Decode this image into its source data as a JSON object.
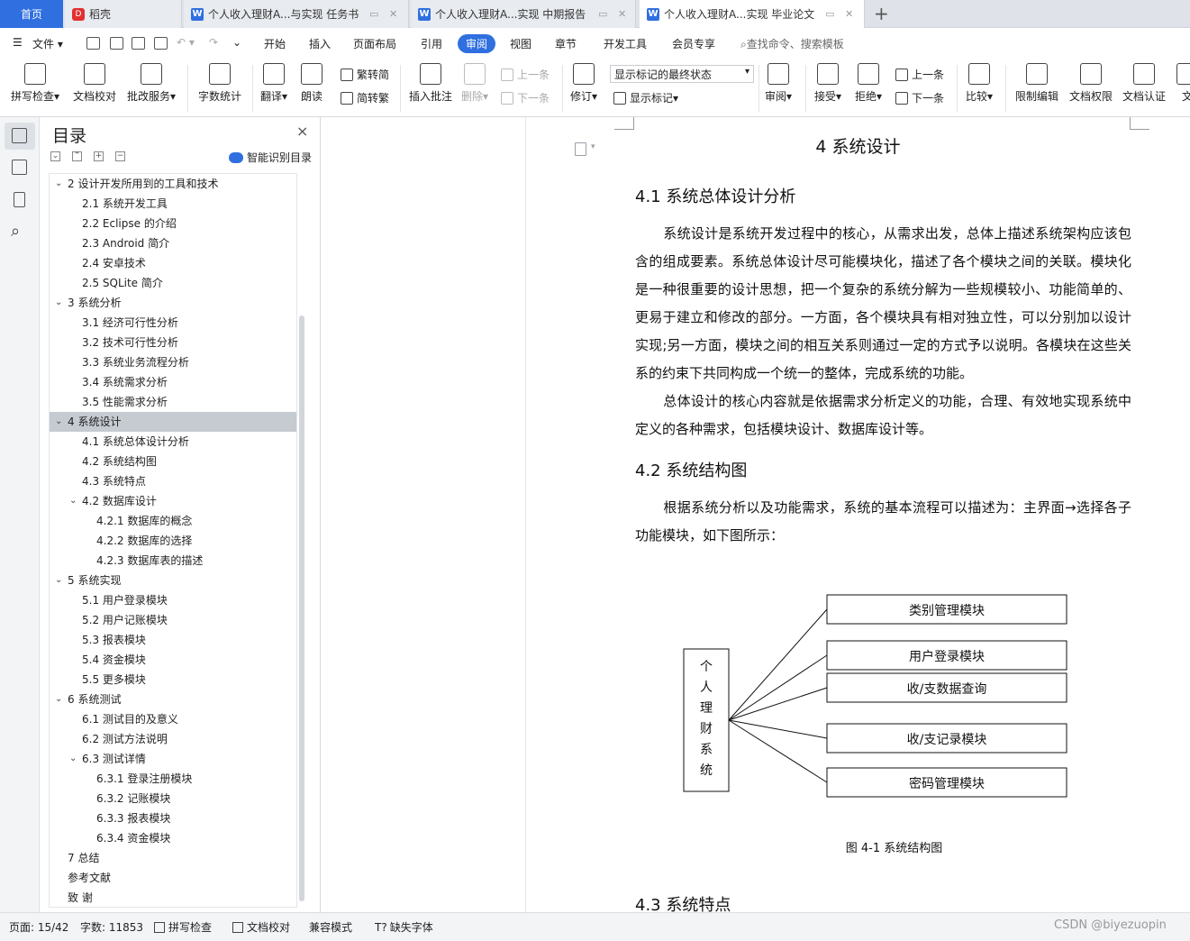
{
  "tabs": {
    "home": "首页",
    "daoke": "稻壳",
    "doc1": "个人收入理财A...与实现 任务书",
    "doc2": "个人收入理财A...实现 中期报告",
    "doc3": "个人收入理财A...实现 毕业论文",
    "add": "+"
  },
  "menu": {
    "file": "文件",
    "items": [
      "开始",
      "插入",
      "页面布局",
      "引用",
      "审阅",
      "视图",
      "章节",
      "开发工具",
      "会员专享"
    ],
    "active": "审阅",
    "search": "查找命令、搜索模板"
  },
  "ribbon": {
    "spell": "拼写检查",
    "proof": "文档校对",
    "annot": "批改服务",
    "wordcount": "字数统计",
    "translate": "翻译",
    "read": "朗读",
    "to_trad": "繁转简",
    "to_simp": "简转繁",
    "insert_comment": "插入批注",
    "delete": "删除",
    "prev": "上一条",
    "next": "下一条",
    "track": "修订",
    "markstate": "显示标记的最终状态",
    "showmarks": "显示标记",
    "review": "审阅",
    "accept": "接受",
    "reject": "拒绝",
    "prev2": "上一条",
    "next2": "下一条",
    "compare": "比较",
    "restrict": "限制编辑",
    "perm": "文档权限",
    "cert": "文档认证",
    "more": "文"
  },
  "toc": {
    "title": "目录",
    "close": "×",
    "smart": "智能识别目录",
    "items": [
      {
        "text": "2 设计开发所用到的工具和技术",
        "level": 1,
        "chev": "v"
      },
      {
        "text": "2.1 系统开发工具",
        "level": 2
      },
      {
        "text": "2.2 Eclipse 的介绍",
        "level": 2
      },
      {
        "text": "2.3 Android 简介",
        "level": 2
      },
      {
        "text": "2.4 安卓技术",
        "level": 2
      },
      {
        "text": "2.5 SQLite 简介",
        "level": 2
      },
      {
        "text": "3 系统分析",
        "level": 1,
        "chev": "v"
      },
      {
        "text": "3.1  经济可行性分析",
        "level": 2
      },
      {
        "text": "3.2  技术可行性分析",
        "level": 2
      },
      {
        "text": "3.3  系统业务流程分析",
        "level": 2
      },
      {
        "text": "3.4  系统需求分析",
        "level": 2
      },
      {
        "text": "3.5  性能需求分析",
        "level": 2
      },
      {
        "text": "4 系统设计",
        "level": 1,
        "chev": "v",
        "selected": true
      },
      {
        "text": "4.1 系统总体设计分析",
        "level": 2
      },
      {
        "text": "4.2 系统结构图",
        "level": 2
      },
      {
        "text": "4.3 系统特点",
        "level": 2
      },
      {
        "text": "4.2 数据库设计",
        "level": 2,
        "chev": "v"
      },
      {
        "text": "4.2.1 数据库的概念",
        "level": 3
      },
      {
        "text": "4.2.2 数据库的选择",
        "level": 3
      },
      {
        "text": "4.2.3 数据库表的描述",
        "level": 3
      },
      {
        "text": "5 系统实现",
        "level": 1,
        "chev": "v"
      },
      {
        "text": "5.1 用户登录模块",
        "level": 2
      },
      {
        "text": "5.2 用户记账模块",
        "level": 2
      },
      {
        "text": "5.3 报表模块",
        "level": 2
      },
      {
        "text": "5.4 资金模块",
        "level": 2
      },
      {
        "text": "5.5 更多模块",
        "level": 2
      },
      {
        "text": "6 系统测试",
        "level": 1,
        "chev": "v"
      },
      {
        "text": "6.1 测试目的及意义",
        "level": 2
      },
      {
        "text": "6.2 测试方法说明",
        "level": 2
      },
      {
        "text": "6.3 测试详情",
        "level": 2,
        "chev": "v"
      },
      {
        "text": "6.3.1  登录注册模块",
        "level": 3
      },
      {
        "text": "6.3.2  记账模块",
        "level": 3
      },
      {
        "text": "6.3.3  报表模块",
        "level": 3
      },
      {
        "text": "6.3.4  资金模块",
        "level": 3
      },
      {
        "text": "7 总结",
        "level": 1
      },
      {
        "text": "参考文献",
        "level": 1
      },
      {
        "text": "致    谢",
        "level": 1
      }
    ]
  },
  "doc": {
    "h1": "4 系统设计",
    "h2_1": "4.1 系统总体设计分析",
    "p1": "系统设计是系统开发过程中的核心，从需求出发，总体上描述系统架构应该包含的组成要素。系统总体设计尽可能模块化，描述了各个模块之间的关联。模块化是一种很重要的设计思想，把一个复杂的系统分解为一些规模较小、功能简单的、更易于建立和修改的部分。一方面，各个模块具有相对独立性，可以分别加以设计实现;另一方面，模块之间的相互关系则通过一定的方式予以说明。各模块在这些关系的约束下共同构成一个统一的整体，完成系统的功能。",
    "p2": "总体设计的核心内容就是依据需求分析定义的功能，合理、有效地实现系统中定义的各种需求，包括模块设计、数据库设计等。",
    "h2_2": "4.2 系统结构图",
    "p3": "根据系统分析以及功能需求，系统的基本流程可以描述为：主界面→选择各子功能模块，如下图所示：",
    "diagram": {
      "root": [
        "个",
        "人",
        "理",
        "财",
        "系",
        "统"
      ],
      "modules": [
        "类别管理模块",
        "用户登录模块",
        "收/支数据查询",
        "收/支记录模块",
        "密码管理模块"
      ]
    },
    "caption": "图 4-1  系统结构图",
    "h2_3": "4.3 系统特点"
  },
  "status": {
    "page": "页面: 15/42",
    "words": "字数: 11853",
    "spell": "拼写检查",
    "proof": "文档校对",
    "compat": "兼容模式",
    "font": "缺失字体",
    "watermark": "CSDN @biyezuopin"
  }
}
